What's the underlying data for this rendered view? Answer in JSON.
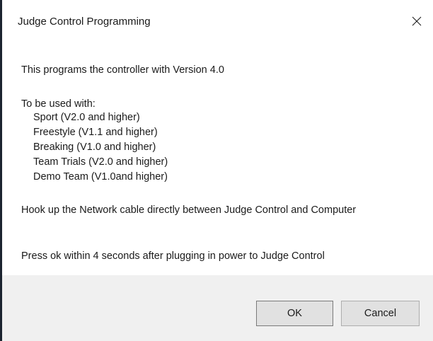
{
  "window": {
    "title": "Judge Control Programming",
    "close_icon": "close-icon"
  },
  "content": {
    "line_intro": "This programs the controller with Version 4.0",
    "line_usage_header": "To be used with:",
    "compatible_items": [
      "Sport (V2.0 and higher)",
      "Freestyle (V1.1 and higher)",
      "Breaking (V1.0 and higher)",
      "Team Trials (V2.0 and higher)",
      "Demo Team (V1.0and higher)"
    ],
    "line_hookup": "Hook up the Network cable directly between Judge Control and Computer",
    "line_press": "Press ok within 4 seconds after plugging in power to Judge Control"
  },
  "buttons": {
    "ok_label": "OK",
    "cancel_label": "Cancel"
  },
  "colors": {
    "footer_background": "#f0f0f0",
    "button_face": "#e1e1e1",
    "left_edge": "#1c2430"
  }
}
